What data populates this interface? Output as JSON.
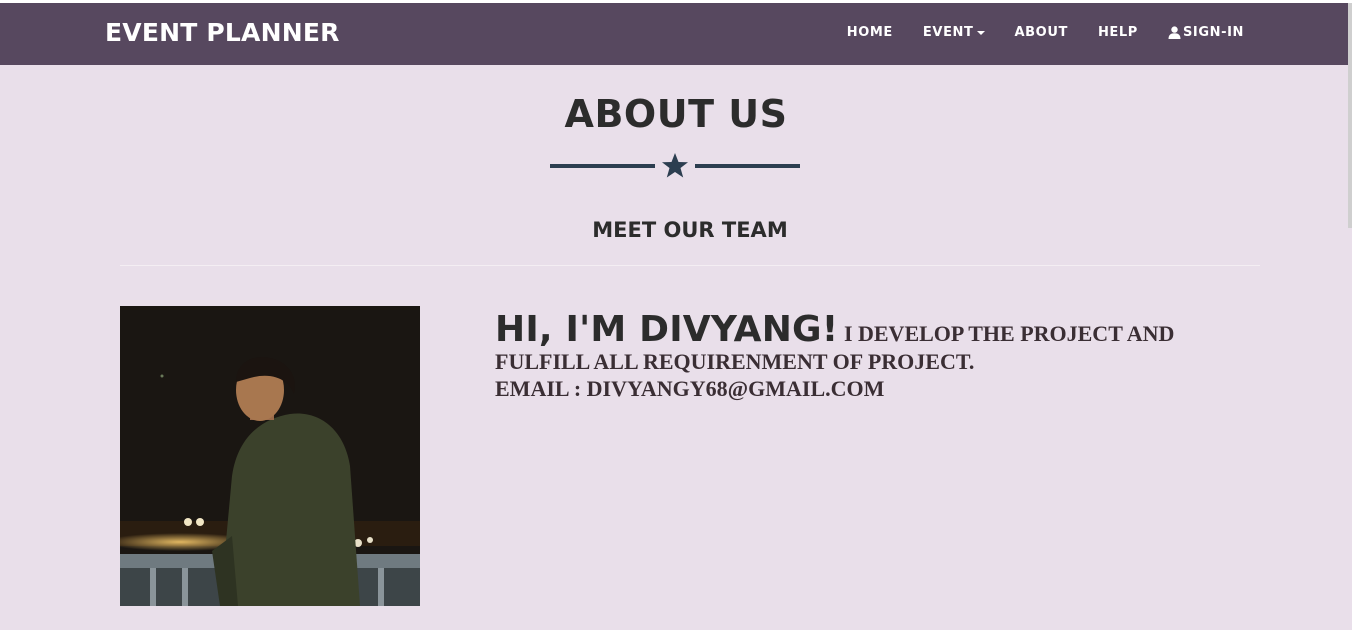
{
  "brand": "EVENT PLANNER",
  "nav": {
    "home": "HOME",
    "event": "EVENT",
    "about": "ABOUT",
    "help": "HELP",
    "signin": "SIGN-IN"
  },
  "page": {
    "title": "ABOUT US",
    "subtitle": "MEET OUR TEAM"
  },
  "member": {
    "greeting": "HI, I'M DIVYANG!",
    "description": " I DEVELOP THE PROJECT AND FULFILL ALL REQUIRENMENT OF PROJECT.",
    "email": "EMAIL : DIVYANGY68@GMAIL.COM"
  },
  "colors": {
    "navbar": "#57485f",
    "background": "#e9dfea",
    "divider": "#2c3e50"
  },
  "icons": {
    "caret": "chevron-down-icon",
    "user": "user-icon",
    "star": "star-icon"
  }
}
